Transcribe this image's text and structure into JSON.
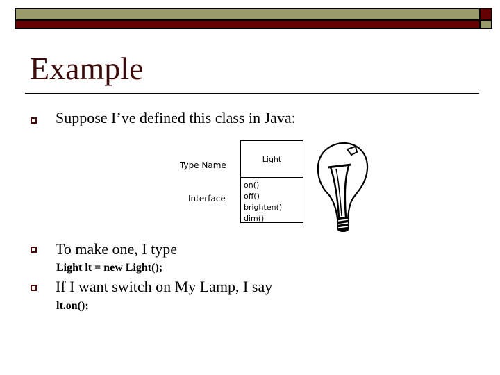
{
  "slide": {
    "title": "Example",
    "bullets": [
      {
        "text": "Suppose I’ve defined this class in Java:"
      },
      {
        "text": "To make one, I type",
        "code": "Light lt = new Light();"
      },
      {
        "text": "If I want switch on My Lamp, I say",
        "code": "lt.on();"
      }
    ]
  },
  "diagram": {
    "type_name_label": "Type Name",
    "interface_label": "Interface",
    "class_name": "Light",
    "methods": [
      "on()",
      "off()",
      "brighten()",
      "dim()"
    ],
    "image": "light-bulb-icon"
  },
  "colors": {
    "olive": "#9a9a6b",
    "dark_red": "#650000",
    "title": "#3b0a0a"
  }
}
